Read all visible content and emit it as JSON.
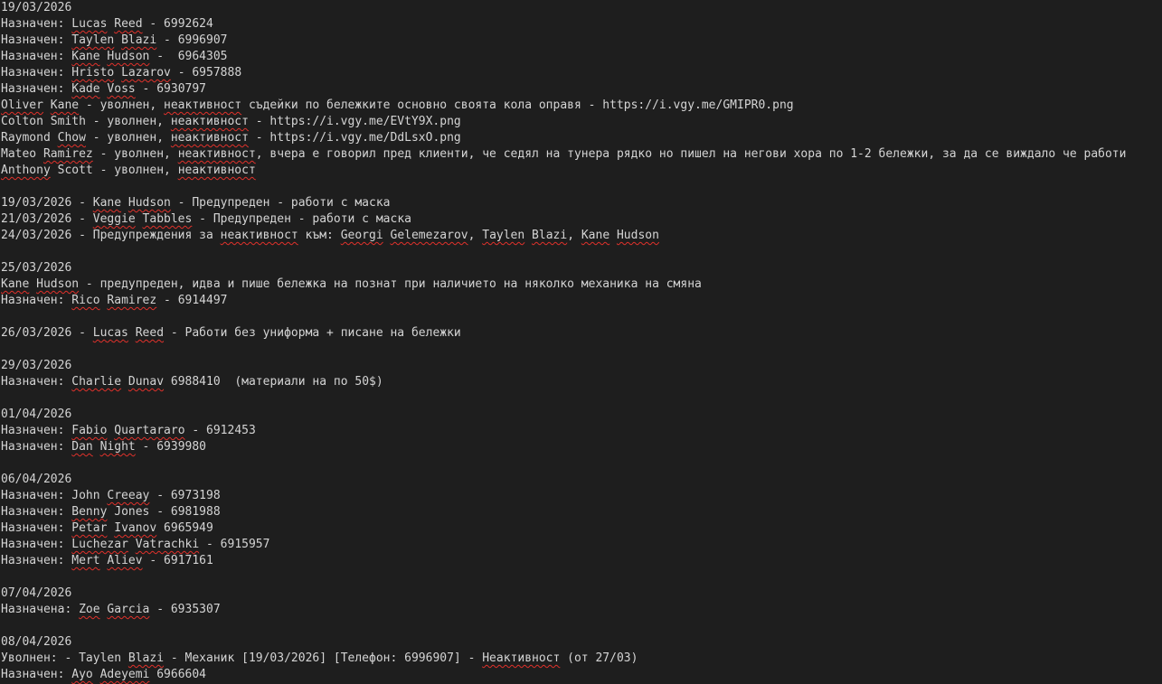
{
  "lines": [
    [
      {
        "t": "19/03/2026"
      }
    ],
    [
      {
        "t": "Назначен: "
      },
      {
        "t": "Lucas",
        "s": 1
      },
      {
        "t": " "
      },
      {
        "t": "Reed",
        "s": 1
      },
      {
        "t": " - 6992624"
      }
    ],
    [
      {
        "t": "Назначен: "
      },
      {
        "t": "Taylen",
        "s": 1
      },
      {
        "t": " "
      },
      {
        "t": "Blazi",
        "s": 1
      },
      {
        "t": " - 6996907"
      }
    ],
    [
      {
        "t": "Назначен: "
      },
      {
        "t": "Kane",
        "s": 1
      },
      {
        "t": " "
      },
      {
        "t": "Hudson",
        "s": 1
      },
      {
        "t": " -  6964305"
      }
    ],
    [
      {
        "t": "Назначен: "
      },
      {
        "t": "Hristo",
        "s": 1
      },
      {
        "t": " "
      },
      {
        "t": "Lazarov",
        "s": 1
      },
      {
        "t": " - 6957888"
      }
    ],
    [
      {
        "t": "Назначен: "
      },
      {
        "t": "Kade",
        "s": 1
      },
      {
        "t": " "
      },
      {
        "t": "Voss",
        "s": 1
      },
      {
        "t": " - 6930797"
      }
    ],
    [
      {
        "t": "Oliver",
        "s": 1
      },
      {
        "t": " "
      },
      {
        "t": "Kane",
        "s": 1
      },
      {
        "t": " - уволнен, "
      },
      {
        "t": "неактивност",
        "s": 1
      },
      {
        "t": " съдейки по бележките основно своята кола оправя - https://i.vgy.me/GMIPR0.png"
      }
    ],
    [
      {
        "t": "Colton Smith - уволнен, "
      },
      {
        "t": "неактивност",
        "s": 1
      },
      {
        "t": " - https://i.vgy.me/EVtY9X.png"
      }
    ],
    [
      {
        "t": "Raymond "
      },
      {
        "t": "Chow",
        "s": 1
      },
      {
        "t": " - уволнен, "
      },
      {
        "t": "неактивност",
        "s": 1
      },
      {
        "t": " - https://i.vgy.me/DdLsxO.png"
      }
    ],
    [
      {
        "t": "Mateo "
      },
      {
        "t": "Ramirez",
        "s": 1
      },
      {
        "t": " - уволнен, "
      },
      {
        "t": "неактивност",
        "s": 1
      },
      {
        "t": ", вчера е говорил пред клиенти, че седял на тунера рядко но пишел на негови хора по 1-2 бележки, за да се виждало че работи"
      }
    ],
    [
      {
        "t": "Anthony",
        "s": 1
      },
      {
        "t": " Scott - уволнен, "
      },
      {
        "t": "неактивност",
        "s": 1
      }
    ],
    [
      {
        "t": ""
      }
    ],
    [
      {
        "t": "19/03/2026 - "
      },
      {
        "t": "Kane",
        "s": 1
      },
      {
        "t": " "
      },
      {
        "t": "Hudson",
        "s": 1
      },
      {
        "t": " - Предупреден - работи с маска"
      }
    ],
    [
      {
        "t": "21/03/2026 - "
      },
      {
        "t": "Veggie",
        "s": 1
      },
      {
        "t": " "
      },
      {
        "t": "Tabbles",
        "s": 1
      },
      {
        "t": " - Предупреден - работи с маска"
      }
    ],
    [
      {
        "t": "24/03/2026 - Предупреждения за "
      },
      {
        "t": "неактивност",
        "s": 1
      },
      {
        "t": " към: "
      },
      {
        "t": "Georgi",
        "s": 1
      },
      {
        "t": " "
      },
      {
        "t": "Gelemezarov",
        "s": 1
      },
      {
        "t": ", "
      },
      {
        "t": "Taylen",
        "s": 1
      },
      {
        "t": " "
      },
      {
        "t": "Blazi",
        "s": 1
      },
      {
        "t": ", "
      },
      {
        "t": "Kane",
        "s": 1
      },
      {
        "t": " "
      },
      {
        "t": "Hudson",
        "s": 1
      }
    ],
    [
      {
        "t": ""
      }
    ],
    [
      {
        "t": "25/03/2026"
      }
    ],
    [
      {
        "t": "Kane",
        "s": 1
      },
      {
        "t": " "
      },
      {
        "t": "Hudson",
        "s": 1
      },
      {
        "t": " - предупреден, идва и пише бележка на познат при наличието на няколко механика на смяна"
      }
    ],
    [
      {
        "t": "Назначен: "
      },
      {
        "t": "Rico",
        "s": 1
      },
      {
        "t": " "
      },
      {
        "t": "Ramirez",
        "s": 1
      },
      {
        "t": " - 6914497"
      }
    ],
    [
      {
        "t": ""
      }
    ],
    [
      {
        "t": "26/03/2026 - "
      },
      {
        "t": "Lucas",
        "s": 1
      },
      {
        "t": " "
      },
      {
        "t": "Reed",
        "s": 1
      },
      {
        "t": " - Работи без униформа + писане на бележки"
      }
    ],
    [
      {
        "t": ""
      }
    ],
    [
      {
        "t": "29/03/2026"
      }
    ],
    [
      {
        "t": "Назначен: "
      },
      {
        "t": "Charlie",
        "s": 1
      },
      {
        "t": " "
      },
      {
        "t": "Dunav",
        "s": 1
      },
      {
        "t": " 6988410  (материали на по 50$)"
      }
    ],
    [
      {
        "t": ""
      }
    ],
    [
      {
        "t": "01/04/2026"
      }
    ],
    [
      {
        "t": "Назначен: "
      },
      {
        "t": "Fabio",
        "s": 1
      },
      {
        "t": " "
      },
      {
        "t": "Quartararo",
        "s": 1
      },
      {
        "t": " - 6912453"
      }
    ],
    [
      {
        "t": "Назначен: "
      },
      {
        "t": "Dan",
        "s": 1
      },
      {
        "t": " "
      },
      {
        "t": "Night",
        "s": 1
      },
      {
        "t": " - 6939980"
      }
    ],
    [
      {
        "t": ""
      }
    ],
    [
      {
        "t": "06/04/2026"
      }
    ],
    [
      {
        "t": "Назначен: John "
      },
      {
        "t": "Creeay",
        "s": 1
      },
      {
        "t": " - 6973198"
      }
    ],
    [
      {
        "t": "Назначен: "
      },
      {
        "t": "Benny",
        "s": 1
      },
      {
        "t": " Jones - 6981988"
      }
    ],
    [
      {
        "t": "Назначен: "
      },
      {
        "t": "Petar",
        "s": 1
      },
      {
        "t": " "
      },
      {
        "t": "Ivanov",
        "s": 1
      },
      {
        "t": " 6965949"
      }
    ],
    [
      {
        "t": "Назначен: "
      },
      {
        "t": "Luchezar",
        "s": 1
      },
      {
        "t": " "
      },
      {
        "t": "Vatrachki",
        "s": 1
      },
      {
        "t": " - 6915957"
      }
    ],
    [
      {
        "t": "Назначен: "
      },
      {
        "t": "Mert",
        "s": 1
      },
      {
        "t": " "
      },
      {
        "t": "Aliev",
        "s": 1
      },
      {
        "t": " - 6917161"
      }
    ],
    [
      {
        "t": ""
      }
    ],
    [
      {
        "t": "07/04/2026"
      }
    ],
    [
      {
        "t": "Назначена: "
      },
      {
        "t": "Zoe",
        "s": 1
      },
      {
        "t": " "
      },
      {
        "t": "Garcia",
        "s": 1
      },
      {
        "t": " - 6935307"
      }
    ],
    [
      {
        "t": ""
      }
    ],
    [
      {
        "t": "08/04/2026"
      }
    ],
    [
      {
        "t": "Уволнен: - Taylen "
      },
      {
        "t": "Blazi",
        "s": 1
      },
      {
        "t": " - Механик [19/03/2026] [Телефон: 6996907] - "
      },
      {
        "t": "Неактивност",
        "s": 1
      },
      {
        "t": " (от 27/03)"
      }
    ],
    [
      {
        "t": "Назначен: "
      },
      {
        "t": "Ayo",
        "s": 1
      },
      {
        "t": " "
      },
      {
        "t": "Adeyemi",
        "s": 1
      },
      {
        "t": " 6966604"
      }
    ]
  ]
}
